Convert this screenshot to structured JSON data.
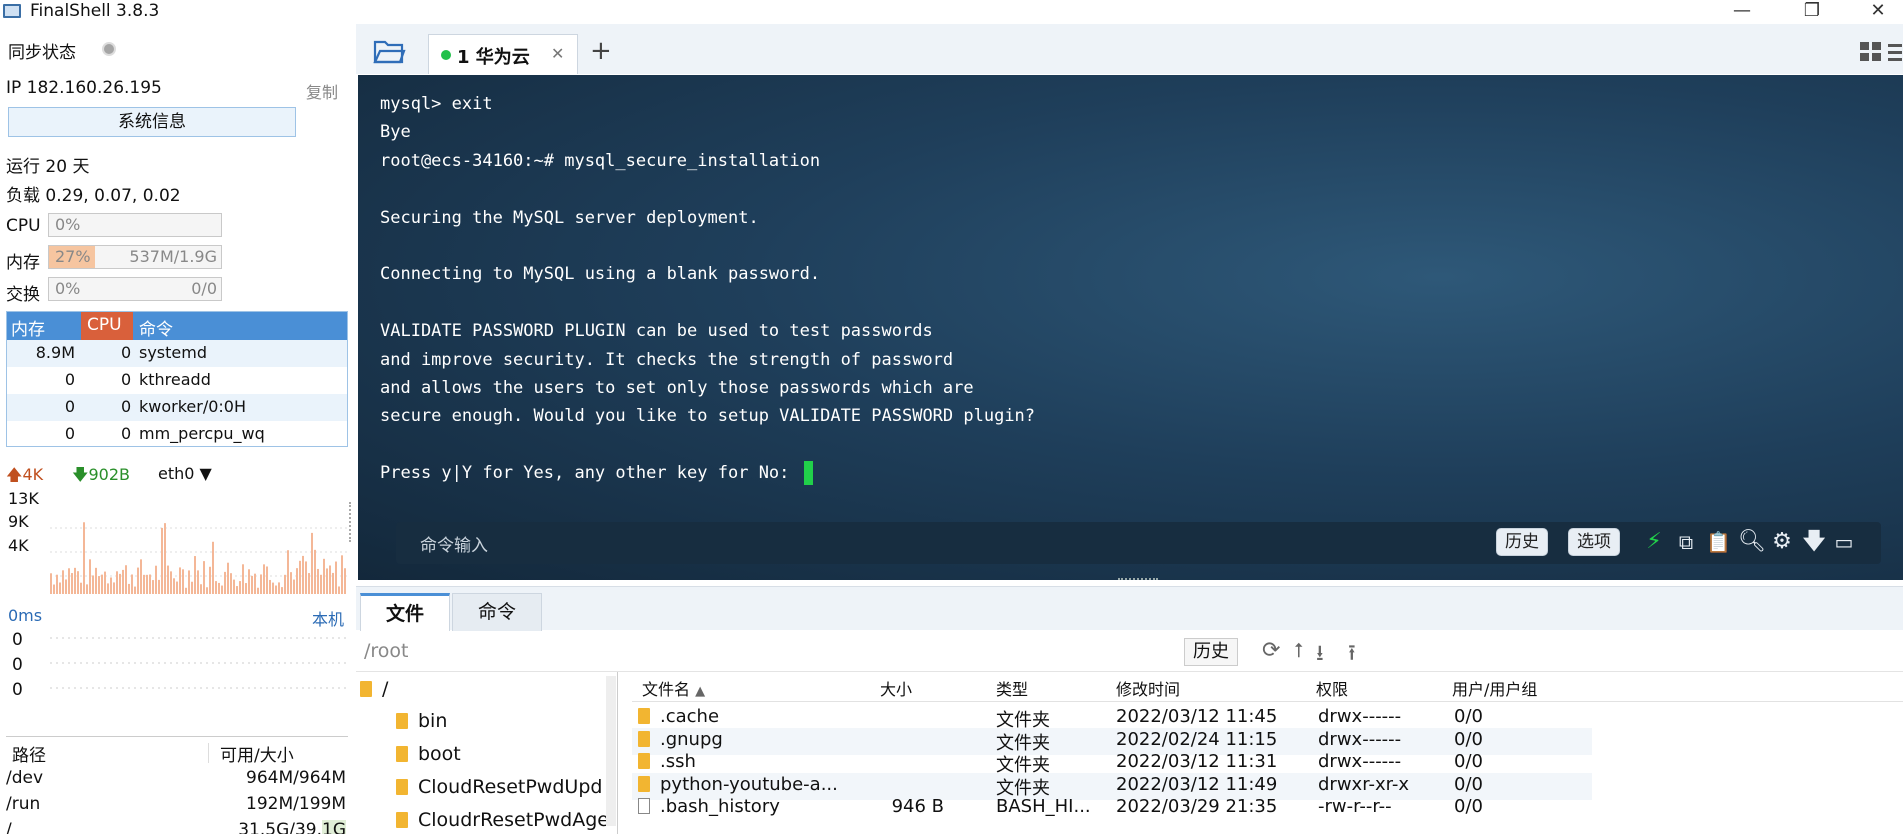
{
  "window": {
    "title": "FinalShell 3.8.3",
    "minimize": "—",
    "restore": "❐",
    "close": "✕"
  },
  "sidebar": {
    "sync_label": "同步状态",
    "ip_label": "IP 182.160.26.195",
    "copy_label": "复制",
    "sysinfo_button": "系统信息",
    "uptime": "运行 20 天",
    "load": "负载 0.29, 0.07, 0.02",
    "cpu": {
      "label": "CPU",
      "pct": "0%",
      "fraction": 0
    },
    "mem": {
      "label": "内存",
      "pct": "27%",
      "value": "537M/1.9G",
      "fraction": 0.27
    },
    "swap": {
      "label": "交换",
      "pct": "0%",
      "value": "0/0",
      "fraction": 0
    },
    "proc_headers": [
      "内存",
      "CPU",
      "命令"
    ],
    "processes": [
      {
        "mem": "8.9M",
        "cpu": "0",
        "cmd": "systemd"
      },
      {
        "mem": "0",
        "cpu": "0",
        "cmd": "kthreadd"
      },
      {
        "mem": "0",
        "cpu": "0",
        "cmd": "kworker/0:0H"
      },
      {
        "mem": "0",
        "cpu": "0",
        "cmd": "mm_percpu_wq"
      }
    ],
    "net": {
      "up": "4K",
      "down": "902B",
      "iface": "eth0",
      "y_ticks": [
        "13K",
        "9K",
        "4K"
      ]
    },
    "ping": {
      "latency": "0ms",
      "target": "本机",
      "values": [
        "0",
        "0",
        "0"
      ]
    },
    "disk_headers": [
      "路径",
      "可用/大小"
    ],
    "disks": [
      {
        "path": "/dev",
        "size": "964M/964M"
      },
      {
        "path": "/run",
        "size": "192M/199M"
      },
      {
        "path": "/",
        "size": "31.5G/39.1G"
      }
    ]
  },
  "tabs": {
    "session_label": "1 华为云",
    "close": "✕",
    "add": "+"
  },
  "terminal": {
    "lines": [
      "mysql> exit",
      "Bye",
      "root@ecs-34160:~# mysql_secure_installation",
      "",
      "Securing the MySQL server deployment.",
      "",
      "Connecting to MySQL using a blank password.",
      "",
      "VALIDATE PASSWORD PLUGIN can be used to test passwords",
      "and improve security. It checks the strength of password",
      "and allows the users to set only those passwords which are",
      "secure enough. Would you like to setup VALIDATE PASSWORD plugin?",
      "",
      "Press y|Y for Yes, any other key for No: "
    ],
    "command_placeholder": "命令输入",
    "history_button": "历史",
    "options_button": "选项"
  },
  "bottom": {
    "tab_files": "文件",
    "tab_commands": "命令",
    "path": "/root",
    "history_button": "历史",
    "tree": [
      "/",
      "bin",
      "boot",
      "CloudResetPwdUpd",
      "CloudrResetPwdAge"
    ],
    "columns": [
      "文件名",
      "大小",
      "类型",
      "修改时间",
      "权限",
      "用户/用户组"
    ],
    "files": [
      {
        "name": ".cache",
        "size": "",
        "type": "文件夹",
        "modified": "2022/03/12 11:45",
        "perm": "drwx------",
        "owner": "0/0",
        "kind": "folder"
      },
      {
        "name": ".gnupg",
        "size": "",
        "type": "文件夹",
        "modified": "2022/02/24 11:15",
        "perm": "drwx------",
        "owner": "0/0",
        "kind": "folder"
      },
      {
        "name": ".ssh",
        "size": "",
        "type": "文件夹",
        "modified": "2022/03/12 11:31",
        "perm": "drwx------",
        "owner": "0/0",
        "kind": "folder"
      },
      {
        "name": "python-youtube-a...",
        "size": "",
        "type": "文件夹",
        "modified": "2022/03/12 11:49",
        "perm": "drwxr-xr-x",
        "owner": "0/0",
        "kind": "folder"
      },
      {
        "name": ".bash_history",
        "size": "946 B",
        "type": "BASH_HI...",
        "modified": "2022/03/29 21:35",
        "perm": "-rw-r--r--",
        "owner": "0/0",
        "kind": "file"
      }
    ]
  },
  "colors": {
    "accent": "#4a8fd6",
    "cpu_header": "#d9603b",
    "terminal_bg": "#1f3f5b",
    "cursor": "#21d04a",
    "folder": "#f2b531"
  }
}
